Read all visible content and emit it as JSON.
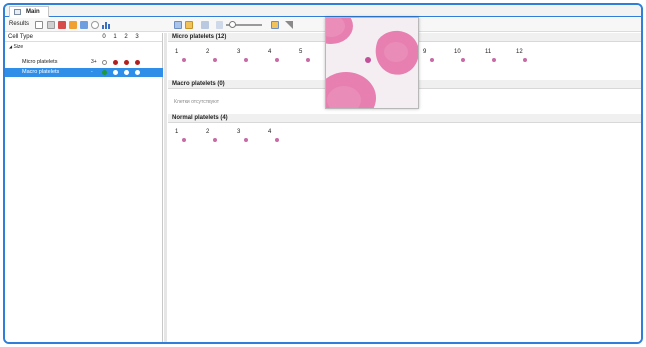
{
  "window": {
    "tab_label": "Main",
    "tab_icon": "window-icon"
  },
  "toolbar": {
    "results_label": "Results",
    "icons": [
      "document-icon",
      "grid-small-icon",
      "grid-red-icon",
      "grid-orange-icon",
      "grid-blue-icon",
      "check-circle-icon",
      "bar-chart-icon",
      "view-mode-icon",
      "grid-view-icon",
      "layers-icon",
      "zoom-out-icon",
      "zoom-slider",
      "image-icon",
      "ruler-icon"
    ]
  },
  "sidebar": {
    "header_title": "Cell Type",
    "columns": [
      "0",
      "1",
      "2",
      "3"
    ],
    "group_label": "Size",
    "rows": [
      {
        "label": "Micro platelets",
        "prefix": "3+",
        "selected": false,
        "dots": [
          "#ffffff",
          "#b21f1f",
          "#b21f1f",
          "#b21f1f"
        ]
      },
      {
        "label": "Macro platelets",
        "prefix": "-",
        "selected": true,
        "dots": [
          "#1f9a3a",
          "#ffffff",
          "#ffffff",
          "#ffffff"
        ]
      }
    ]
  },
  "sections": [
    {
      "title": "Micro platelets (12)",
      "numbers": [
        "1",
        "2",
        "3",
        "4",
        "5",
        "6",
        "7",
        "8",
        "9",
        "10",
        "11",
        "12"
      ]
    },
    {
      "title": "Macro platelets (0)",
      "empty_text": "Клетки отсутствуют"
    },
    {
      "title": "Normal platelets (4)",
      "numbers": [
        "1",
        "2",
        "3",
        "4"
      ]
    }
  ],
  "colors": {
    "accent": "#2f7ed8",
    "selection": "#2e8ee8",
    "platelet": "#c86aa6",
    "rbc": "#e77fb0"
  }
}
